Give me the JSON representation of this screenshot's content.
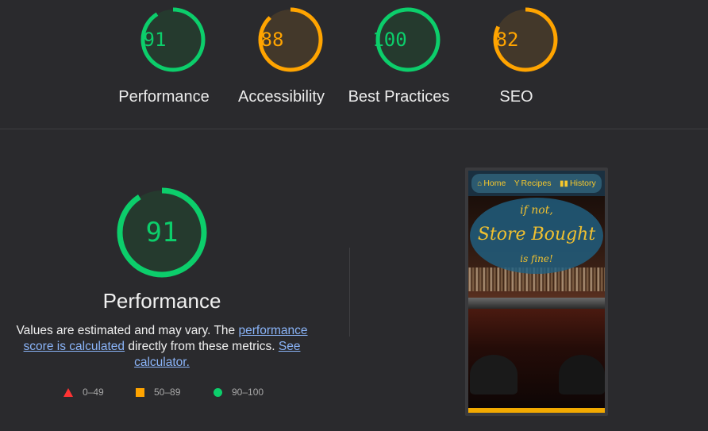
{
  "colors": {
    "pass": "#0cce6b",
    "average": "#ffa400",
    "fail": "#ff3333",
    "link": "#8ab4f8"
  },
  "scores": [
    {
      "label": "Performance",
      "value": "91",
      "status": "pass"
    },
    {
      "label": "Accessibility",
      "value": "88",
      "status": "average"
    },
    {
      "label": "Best Practices",
      "value": "100",
      "status": "pass"
    },
    {
      "label": "SEO",
      "value": "82",
      "status": "average"
    }
  ],
  "detail": {
    "score": "91",
    "title": "Performance",
    "desc_pre": "Values are estimated and may vary. The ",
    "desc_link1": "performance score is calculated",
    "desc_mid": " directly from these metrics. ",
    "desc_link2": "See calculator."
  },
  "legend": [
    {
      "range": "0–49",
      "shape": "triangle"
    },
    {
      "range": "50–89",
      "shape": "square"
    },
    {
      "range": "90–100",
      "shape": "circle"
    }
  ],
  "screenshot": {
    "nav": [
      {
        "icon": "home-icon",
        "label": "Home"
      },
      {
        "icon": "cocktail-icon",
        "label": "Recipes"
      },
      {
        "icon": "book-icon",
        "label": "History"
      }
    ],
    "hero_line1": "if not,",
    "hero_line2": "Store Bought",
    "hero_line3": "is fine!"
  }
}
